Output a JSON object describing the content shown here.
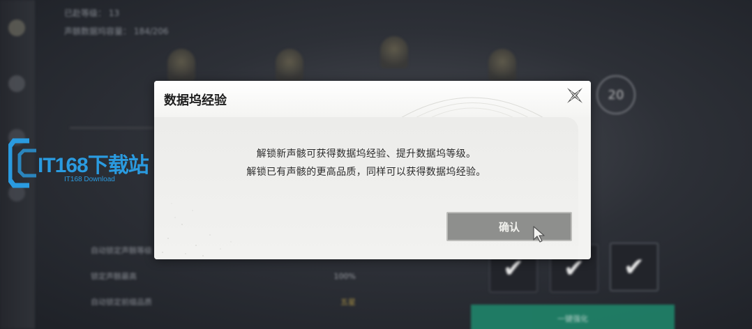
{
  "background": {
    "top_info": [
      {
        "label": "已赴等级：",
        "value": "13"
      },
      {
        "label": "声骸数据坞容量：",
        "value": "184/206"
      }
    ],
    "level_badge": "20",
    "settings_rows": [
      {
        "label": "自动锁定声骸等级",
        "value": ""
      },
      {
        "label": "锁定声骸最高",
        "value": "100%"
      },
      {
        "label": "自动锁定前缀品质",
        "value": "五星"
      }
    ],
    "action_button": "一键强化"
  },
  "watermark": {
    "brand": "IT168下载站",
    "sub": "IT168 Download"
  },
  "dialog": {
    "title": "数据坞经验",
    "lines": [
      "解锁新声骸可获得数据坞经验、提升数据坞等级。",
      "解锁已有声骸的更高品质，同样可以获得数据坞经验。"
    ],
    "confirm_label": "确认"
  },
  "icons": {
    "close": "close-cross-icon",
    "cursor": "mouse-pointer-icon",
    "check": "check-icon"
  },
  "colors": {
    "dialog_bg": "#f3f3f1",
    "confirm_bg": "#8e8f8d",
    "watermark_blue": "#2a9be0",
    "accent_green": "#1f8a6d"
  }
}
